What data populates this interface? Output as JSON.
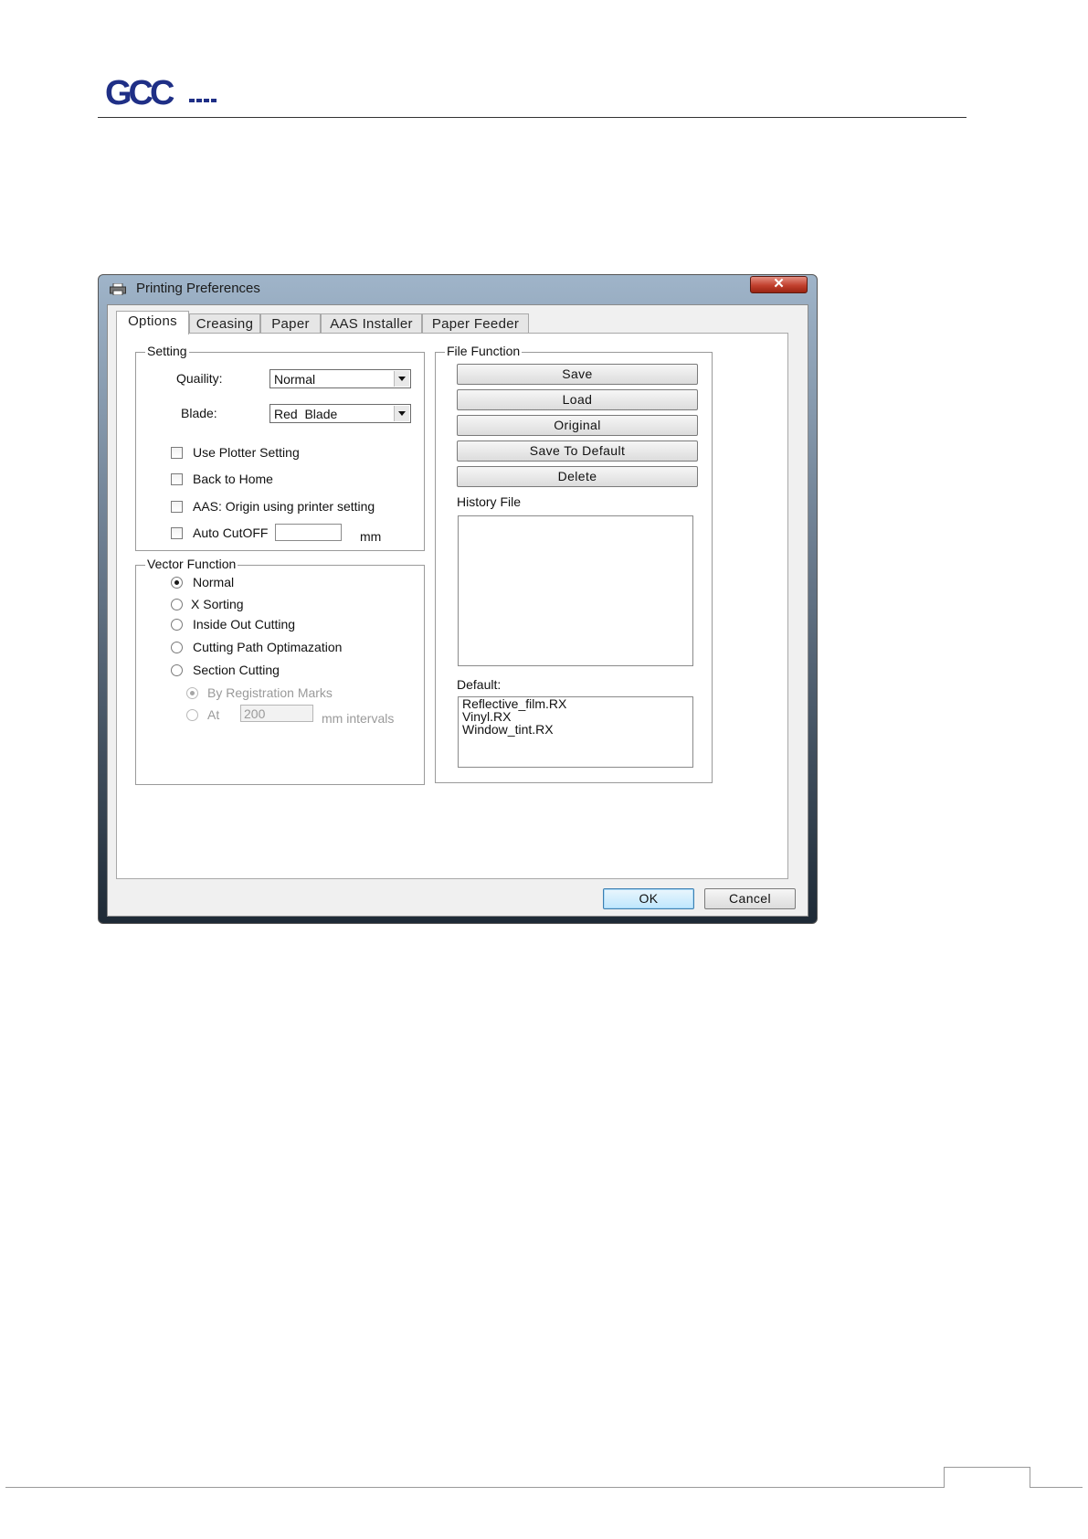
{
  "dialog": {
    "title": "Printing Preferences",
    "close_symbol": "✕"
  },
  "tabs": [
    "Options",
    "Creasing",
    "Paper",
    "AAS Installer",
    "Paper Feeder"
  ],
  "setting": {
    "group_label": "Setting",
    "quality_label": "Quaility:",
    "quality_value": "Normal",
    "blade_label": "Blade:",
    "blade_value": "Red  Blade",
    "use_plotter_setting": "Use Plotter Setting",
    "back_to_home": "Back to Home",
    "aas_origin": "AAS: Origin using printer setting",
    "auto_cutoff": "Auto CutOFF",
    "auto_cutoff_unit": "mm"
  },
  "vector_function": {
    "group_label": "Vector Function",
    "options": [
      "Normal",
      "X Sorting",
      "Inside Out Cutting",
      "Cutting Path Optimazation",
      "Section Cutting"
    ],
    "selected": "Normal",
    "section_sub": {
      "by_marks": "By Registration Marks",
      "at_label": "At",
      "at_value": "200",
      "interval_unit": "mm intervals"
    }
  },
  "file_function": {
    "group_label": "File Function",
    "buttons": [
      "Save",
      "Load",
      "Original",
      "Save To Default",
      "Delete"
    ],
    "history_label": "History File",
    "default_label": "Default:",
    "default_files": [
      "Reflective_film.RX",
      "Vinyl.RX",
      "Window_tint.RX"
    ]
  },
  "footer_buttons": {
    "ok": "OK",
    "cancel": "Cancel"
  },
  "colors": {
    "logo_blue": "#1f2f86",
    "close_red": "#c2402e"
  }
}
